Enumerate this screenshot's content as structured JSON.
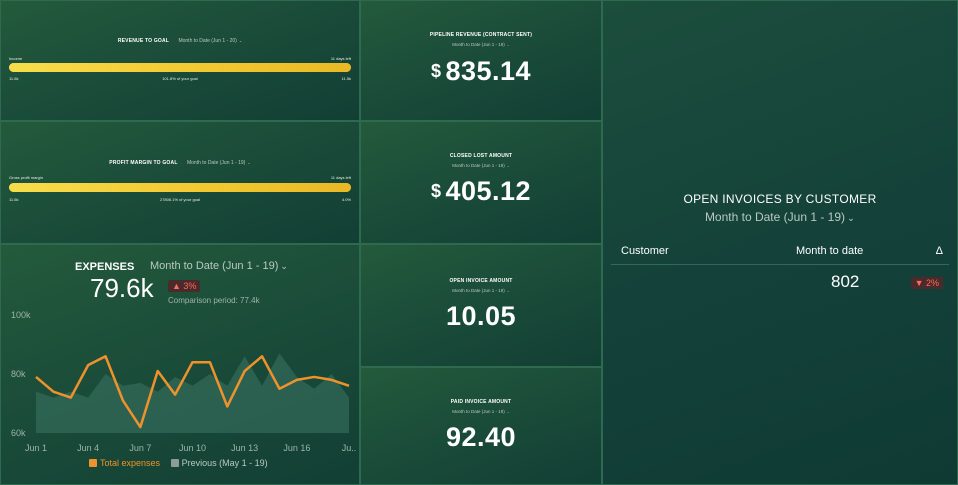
{
  "revenue_goal": {
    "title": "REVENUE TO GOAL",
    "period": "Month to Date (Jun 1 - 20)",
    "label_left": "Income",
    "label_right": "11 days left",
    "value_left": "11.6k",
    "center_text": "101.8% of your goal",
    "value_right": "11.5k",
    "progress": 1.0
  },
  "profit_goal": {
    "title": "PROFIT MARGIN TO GOAL",
    "period": "Month to Date (Jun 1 - 19)",
    "label_left": "Gross profit margin",
    "label_right": "11 days left",
    "value_left": "11.6k",
    "center_text": "27806.1% of your goal",
    "value_right": "4.0%",
    "progress": 1.0
  },
  "pipeline": {
    "title": "PIPELINE REVENUE (CONTRACT SENT)",
    "period": "Month to Date (Jun 1 - 19)",
    "currency": "$",
    "value": "835.14"
  },
  "closed_lost": {
    "title": "CLOSED LOST AMOUNT",
    "period": "Month to Date (Jun 1 - 19)",
    "currency": "$",
    "value": "405.12"
  },
  "open_invoice": {
    "title": "OPEN INVOICE AMOUNT",
    "period": "Month to Date (Jun 1 - 19)",
    "value": "10.05"
  },
  "paid_invoice": {
    "title": "PAID INVOICE AMOUNT",
    "period": "Month to Date (Jun 1 - 19)",
    "value": "92.40"
  },
  "expenses": {
    "title": "EXPENSES",
    "period": "Month to Date (Jun 1 - 19)",
    "value": "79.6k",
    "change": "▲ 3%",
    "comparison": "Comparison period: 77.4k",
    "legend_current": "Total expenses",
    "legend_previous": "Previous (May 1 - 19)"
  },
  "chart_data": {
    "type": "line",
    "ylim": [
      60,
      100
    ],
    "yticks": [
      "100k",
      "80k",
      "60k"
    ],
    "ytick_values": [
      100,
      80,
      60
    ],
    "xticks": [
      "Jun 1",
      "Jun 4",
      "Jun 7",
      "Jun 10",
      "Jun 13",
      "Jun 16",
      "Ju.."
    ],
    "xtick_values": [
      1,
      4,
      7,
      10,
      13,
      16,
      19
    ],
    "x": [
      1,
      2,
      3,
      4,
      5,
      6,
      7,
      8,
      9,
      10,
      11,
      12,
      13,
      14,
      15,
      16,
      17,
      18,
      19
    ],
    "series": [
      {
        "name": "Total expenses",
        "color": "#f0922b",
        "values": [
          79,
          74,
          72,
          83,
          86,
          71,
          62,
          81,
          73,
          84,
          84,
          69,
          81,
          86,
          75,
          78,
          79,
          78,
          76
        ]
      },
      {
        "name": "Previous (May 1 - 19)",
        "color": "#3d7565",
        "values": [
          74,
          72,
          74,
          72,
          80,
          76,
          77,
          74,
          79,
          76,
          80,
          76,
          86,
          76,
          87,
          79,
          75,
          80,
          72
        ]
      }
    ]
  },
  "invoices": {
    "title": "OPEN INVOICES BY CUSTOMER",
    "period": "Month to Date (Jun 1 - 19)",
    "col_customer": "Customer",
    "col_month": "Month to date",
    "col_delta": "Δ",
    "row_value": "802",
    "row_change": "▼ 2%"
  }
}
